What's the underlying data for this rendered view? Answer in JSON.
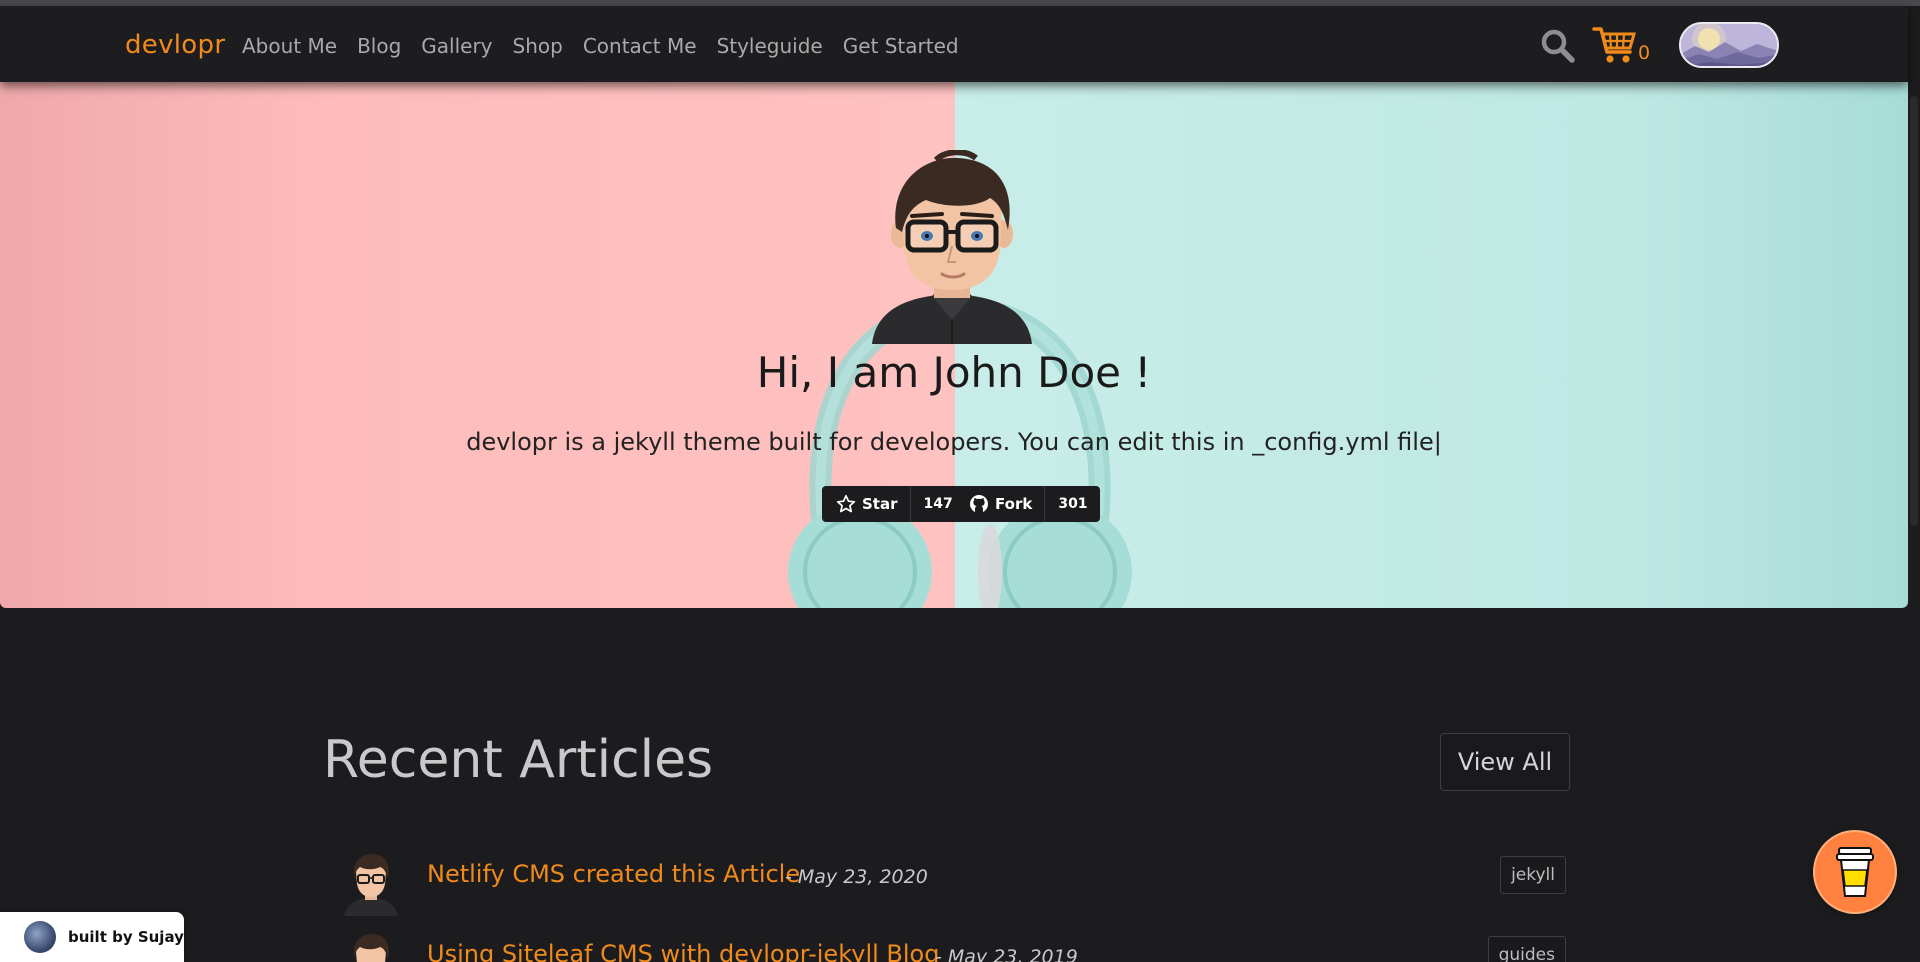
{
  "navbar": {
    "brand": "devlopr",
    "links": [
      "About Me",
      "Blog",
      "Gallery",
      "Shop",
      "Contact Me",
      "Styleguide",
      "Get Started"
    ],
    "cart_count": "0",
    "search_icon": "search-icon",
    "cart_icon": "shopping-cart-icon",
    "theme_toggle_icon": "day-night-toggle-icon",
    "accent_color": "#f08a1b"
  },
  "hero": {
    "title": "Hi, I am John Doe !",
    "subtitle": "devlopr is a jekyll theme built for developers. You can edit this in _config.yml file",
    "caret": "|",
    "star_label": "Star",
    "star_count": "147",
    "fork_label": "Fork",
    "fork_count": "301",
    "left_color": "#fdbcbb",
    "right_color": "#bfe8e3"
  },
  "recent": {
    "title": "Recent Articles",
    "view_all": "View All",
    "articles": [
      {
        "title": "Netlify CMS created this Article",
        "date": "- May 23, 2020",
        "tag": "jekyll"
      },
      {
        "title": "Using Siteleaf CMS with devlopr-jekyll Blog",
        "date": "- May 23, 2019",
        "tag": "guides"
      }
    ]
  },
  "badges": {
    "built_by": "built by Sujay",
    "coffee_icon": "coffee-cup-icon"
  }
}
